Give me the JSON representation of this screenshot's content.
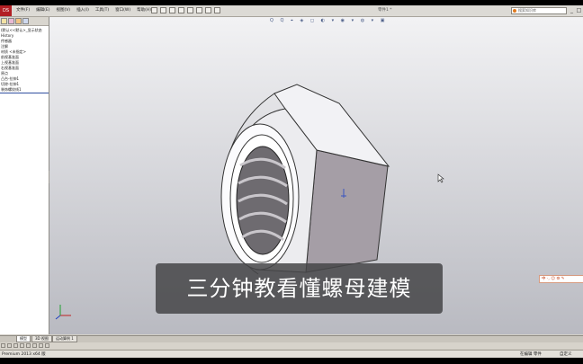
{
  "app": {
    "logo_text": "DS",
    "menus": [
      "文件(F)",
      "编辑(E)",
      "视图(V)",
      "插入(I)",
      "工具(T)",
      "窗口(W)",
      "帮助(H)"
    ],
    "window_title": "零件1 *",
    "search_placeholder": "搜索知识库",
    "min_glyph": "_",
    "max_glyph": "□",
    "close_glyph": "×"
  },
  "feature_tree": {
    "items": [
      "(默认<<默认>_显示状态",
      "History",
      "传感器",
      "注解",
      "材质 <未指定>",
      "前视基准面",
      "上视基准面",
      "右视基准面",
      "原点",
      "凸台-拉伸1",
      "切除-拉伸1",
      "装饰螺纹线1"
    ],
    "selected_index": 11
  },
  "viewport": {
    "heads_up_glyphs": "Q Q ⌖ ◈ ◻ ◐ ▾ ◉ ▾ ◍ ▾ ▣",
    "triad_labels": {
      "x": "x",
      "y": "y",
      "z": "z"
    },
    "ime_text": "中 ·, ☺ ⚙ ✎"
  },
  "subtitle": "三分钟教看懂螺母建模",
  "bottom_tabs": [
    "模型",
    "3D 视图",
    "运动算例 1"
  ],
  "active_bottom_tab": 0,
  "status": {
    "left": "Premium 2013 x64 版",
    "right1": "在编辑 零件",
    "right2": "自定义"
  },
  "colors": {
    "nut_body": "#ededf0",
    "nut_shadow_face": "#a59ea6",
    "accent_logo": "#b21f24",
    "subtitle_bg": "#464648"
  }
}
